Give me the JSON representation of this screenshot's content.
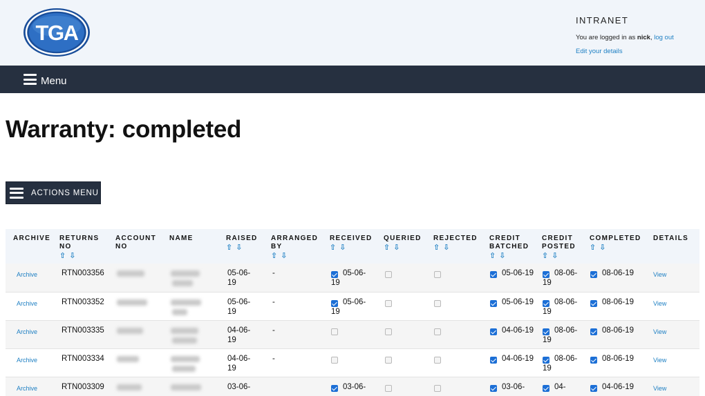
{
  "header": {
    "logo_text": "TGA",
    "section": "INTRANET",
    "logged_prefix": "You are logged in as ",
    "user": "nick",
    "logout": "log out",
    "edit_details": "Edit your details"
  },
  "nav": {
    "menu_label": "Menu"
  },
  "page": {
    "title": "Warranty: completed"
  },
  "actions": {
    "label": "ACTIONS MENU"
  },
  "table": {
    "columns": [
      "ARCHIVE",
      "RETURNS NO",
      "ACCOUNT NO",
      "NAME",
      "RAISED",
      "ARRANGED BY",
      "RECEIVED",
      "QUERIED",
      "REJECTED",
      "CREDIT BATCHED",
      "CREDIT POSTED",
      "COMPLETED",
      "DETAILS"
    ],
    "sort_icons": "⇧⇩",
    "rows": [
      {
        "archive": "Archive",
        "returns_no": "RTN003356",
        "raised": "05-06-19",
        "arranged_by": "-",
        "received": true,
        "received_date": "05-06-19",
        "queried": false,
        "rejected": false,
        "credit_batched": true,
        "credit_batched_date": "05-06-19",
        "credit_posted": true,
        "credit_posted_date": "08-06-19",
        "completed": true,
        "completed_date": "08-06-19",
        "details": "View"
      },
      {
        "archive": "Archive",
        "returns_no": "RTN003352",
        "raised": "05-06-19",
        "arranged_by": "-",
        "received": true,
        "received_date": "05-06-19",
        "queried": false,
        "rejected": false,
        "credit_batched": true,
        "credit_batched_date": "05-06-19",
        "credit_posted": true,
        "credit_posted_date": "08-06-19",
        "completed": true,
        "completed_date": "08-06-19",
        "details": "View"
      },
      {
        "archive": "Archive",
        "returns_no": "RTN003335",
        "raised": "04-06-19",
        "arranged_by": "-",
        "received": false,
        "received_date": "",
        "queried": false,
        "rejected": false,
        "credit_batched": true,
        "credit_batched_date": "04-06-19",
        "credit_posted": true,
        "credit_posted_date": "08-06-19",
        "completed": true,
        "completed_date": "08-06-19",
        "details": "View"
      },
      {
        "archive": "Archive",
        "returns_no": "RTN003334",
        "raised": "04-06-19",
        "arranged_by": "-",
        "received": false,
        "received_date": "",
        "queried": false,
        "rejected": false,
        "credit_batched": true,
        "credit_batched_date": "04-06-19",
        "credit_posted": true,
        "credit_posted_date": "08-06-19",
        "completed": true,
        "completed_date": "08-06-19",
        "details": "View"
      },
      {
        "archive": "Archive",
        "returns_no": "RTN003309",
        "raised": "03-06-",
        "arranged_by": "",
        "received": true,
        "received_date": "03-06-",
        "queried": false,
        "rejected": false,
        "credit_batched": true,
        "credit_batched_date": "03-06-",
        "credit_posted": true,
        "credit_posted_date": "04-",
        "completed": true,
        "completed_date": "04-06-19",
        "details": "View"
      }
    ]
  },
  "colors": {
    "navy": "#263040",
    "link": "#1d7fc3",
    "check": "#1c6fd6",
    "header_bg": "#f1f5fa"
  }
}
